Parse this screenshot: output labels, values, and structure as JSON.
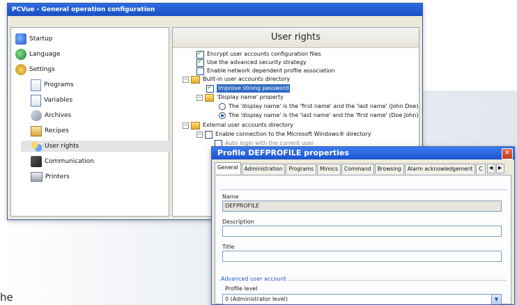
{
  "corner_text": "",
  "bottom_fragment": "he",
  "main_window": {
    "title": "PCVue - General operation configuration",
    "tree": [
      {
        "label": "Startup",
        "icon": "status-icon"
      },
      {
        "label": "Language",
        "icon": "language-icon"
      },
      {
        "label": "Settings",
        "icon": "settings-icon"
      },
      {
        "label": "Programs",
        "icon": "programs-icon"
      },
      {
        "label": "Variables",
        "icon": "variables-icon"
      },
      {
        "label": "Archives",
        "icon": "archives-icon"
      },
      {
        "label": "Recipes",
        "icon": "recipes-icon"
      },
      {
        "label": "User rights",
        "icon": "user-rights-icon",
        "selected": true
      },
      {
        "label": "Communication",
        "icon": "communication-icon"
      },
      {
        "label": "Printers",
        "icon": "printers-icon"
      }
    ],
    "pane_title": "User rights",
    "options": {
      "encrypt": "Encrypt user accounts configuration files",
      "advanced_security": "Use the advanced security strategy",
      "network_profile": "Enable network dependent profile association",
      "builtin_dir": "Built-in user accounts directory",
      "improve_password": "Improve strong password",
      "display_name_prop": "'Display name' property",
      "display_name_opt1": "The 'display name' is the 'first name' and the 'last name' (John Doe)",
      "display_name_opt2": "The 'display name' is the 'last name' and the 'first name' (Doe John)",
      "external_dir": "External user accounts directory",
      "enable_connection": "Enable connection to the Microsoft Windows® directory",
      "auto_login": "Auto login with the current user"
    }
  },
  "dialog": {
    "title": "Profile DEFPROFILE properties",
    "close_glyph": "✕",
    "tabs": [
      "General",
      "Administration",
      "Programs",
      "Mimics",
      "Command",
      "Browsing",
      "Alarm acknowledgement",
      "C"
    ],
    "active_tab": "General",
    "name_label": "Name",
    "name_value": "DEFPROFILE",
    "description_label": "Description",
    "description_value": "",
    "title_label": "Title",
    "title_value": "",
    "advanced_group": "Advanced user account",
    "profile_level_label": "Profile level",
    "profile_level_value": "0 (Administrator level)"
  }
}
